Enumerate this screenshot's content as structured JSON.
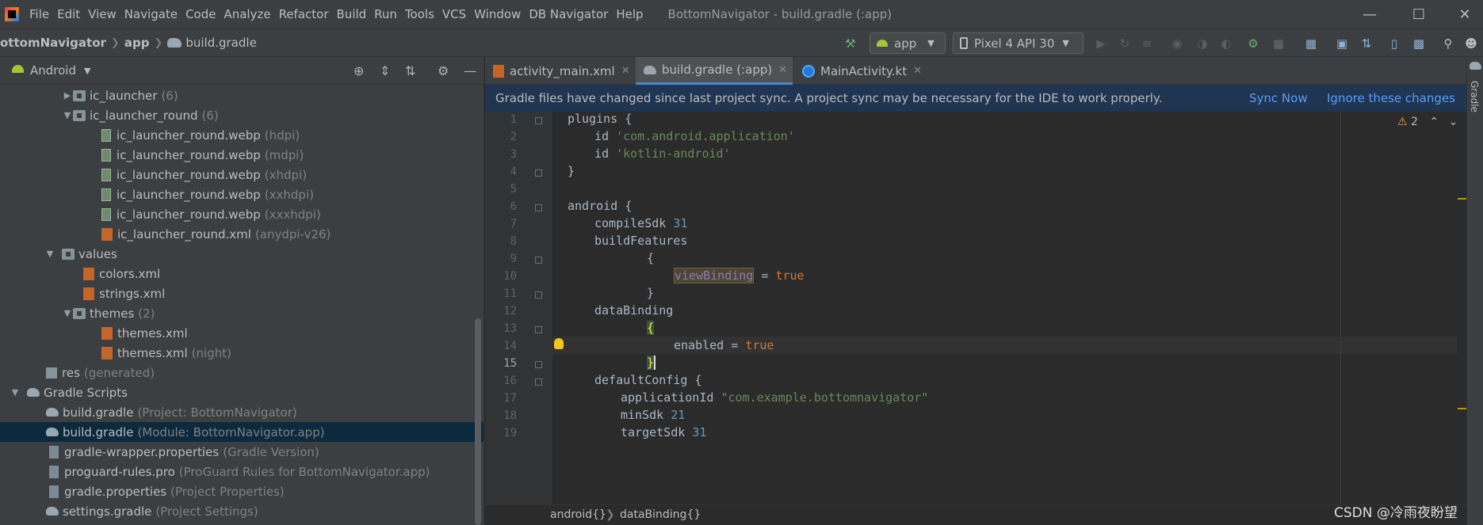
{
  "menu": {
    "items": [
      "File",
      "Edit",
      "View",
      "Navigate",
      "Code",
      "Analyze",
      "Refactor",
      "Build",
      "Run",
      "Tools",
      "VCS",
      "Window",
      "DB Navigator",
      "Help"
    ],
    "window_title": "BottomNavigator - build.gradle (:app)"
  },
  "nav": {
    "project": "ottomNavigator",
    "module": "app",
    "file": "build.gradle",
    "run_config": "app",
    "device": "Pixel 4 API 30"
  },
  "project_panel": {
    "view_mode": "Android",
    "rows": [
      {
        "label": "ic_launcher",
        "hint": "(6)"
      },
      {
        "label": "ic_launcher_round",
        "hint": "(6)"
      },
      {
        "label": "ic_launcher_round.webp",
        "hint": "(hdpi)"
      },
      {
        "label": "ic_launcher_round.webp",
        "hint": "(mdpi)"
      },
      {
        "label": "ic_launcher_round.webp",
        "hint": "(xhdpi)"
      },
      {
        "label": "ic_launcher_round.webp",
        "hint": "(xxhdpi)"
      },
      {
        "label": "ic_launcher_round.webp",
        "hint": "(xxxhdpi)"
      },
      {
        "label": "ic_launcher_round.xml",
        "hint": "(anydpi-v26)"
      },
      {
        "label": "values",
        "hint": ""
      },
      {
        "label": "colors.xml",
        "hint": ""
      },
      {
        "label": "strings.xml",
        "hint": ""
      },
      {
        "label": "themes",
        "hint": "(2)"
      },
      {
        "label": "themes.xml",
        "hint": ""
      },
      {
        "label": "themes.xml",
        "hint": "(night)"
      },
      {
        "label": "res",
        "hint": "(generated)"
      },
      {
        "label": "Gradle Scripts",
        "hint": ""
      },
      {
        "label": "build.gradle",
        "hint": "(Project: BottomNavigator)"
      },
      {
        "label": "build.gradle",
        "hint": "(Module: BottomNavigator.app)"
      },
      {
        "label": "gradle-wrapper.properties",
        "hint": "(Gradle Version)"
      },
      {
        "label": "proguard-rules.pro",
        "hint": "(ProGuard Rules for BottomNavigator.app)"
      },
      {
        "label": "gradle.properties",
        "hint": "(Project Properties)"
      },
      {
        "label": "settings.gradle",
        "hint": "(Project Settings)"
      }
    ]
  },
  "tabs": [
    {
      "label": "activity_main.xml"
    },
    {
      "label": "build.gradle (:app)"
    },
    {
      "label": "MainActivity.kt"
    }
  ],
  "banner": {
    "message": "Gradle files have changed since last project sync. A project sync may be necessary for the IDE to work properly.",
    "sync_now": "Sync Now",
    "ignore": "Ignore these changes"
  },
  "editor": {
    "warning_count": "2",
    "line_numbers": [
      "1",
      "2",
      "3",
      "4",
      "5",
      "6",
      "7",
      "8",
      "9",
      "10",
      "11",
      "12",
      "13",
      "14",
      "15",
      "16",
      "17",
      "18",
      "19"
    ],
    "code": {
      "l1": "plugins {",
      "l2_kw": "id ",
      "l2_str": "'com.android.application'",
      "l3_kw": "id ",
      "l3_str": "'kotlin-android'",
      "l4": "}",
      "l6": "android {",
      "l7_a": "compileSdk ",
      "l7_b": "31",
      "l8": "buildFeatures",
      "l9": "{",
      "l10_a": "viewBinding",
      "l10_b": " = ",
      "l10_c": "true",
      "l11": "}",
      "l12": "dataBinding",
      "l13": "{",
      "l14_a": "enabled = ",
      "l14_b": "true",
      "l15": "}",
      "l16": "defaultConfig {",
      "l17_a": "applicationId ",
      "l17_b": "\"com.example.bottomnavigator\"",
      "l18_a": "minSdk ",
      "l18_b": "21",
      "l19_a": "targetSdk ",
      "l19_b": "31"
    }
  },
  "bottom_breadcrumb": [
    "android{}",
    "dataBinding{}"
  ],
  "right_tool": "Gradle",
  "watermark": "CSDN @冷雨夜盼望",
  "colors": {
    "accent": "#4a88c7",
    "banner": "#203552",
    "selection": "#0d293e",
    "keyword": "#cc7832",
    "string": "#6a8759",
    "number": "#6897bb"
  }
}
